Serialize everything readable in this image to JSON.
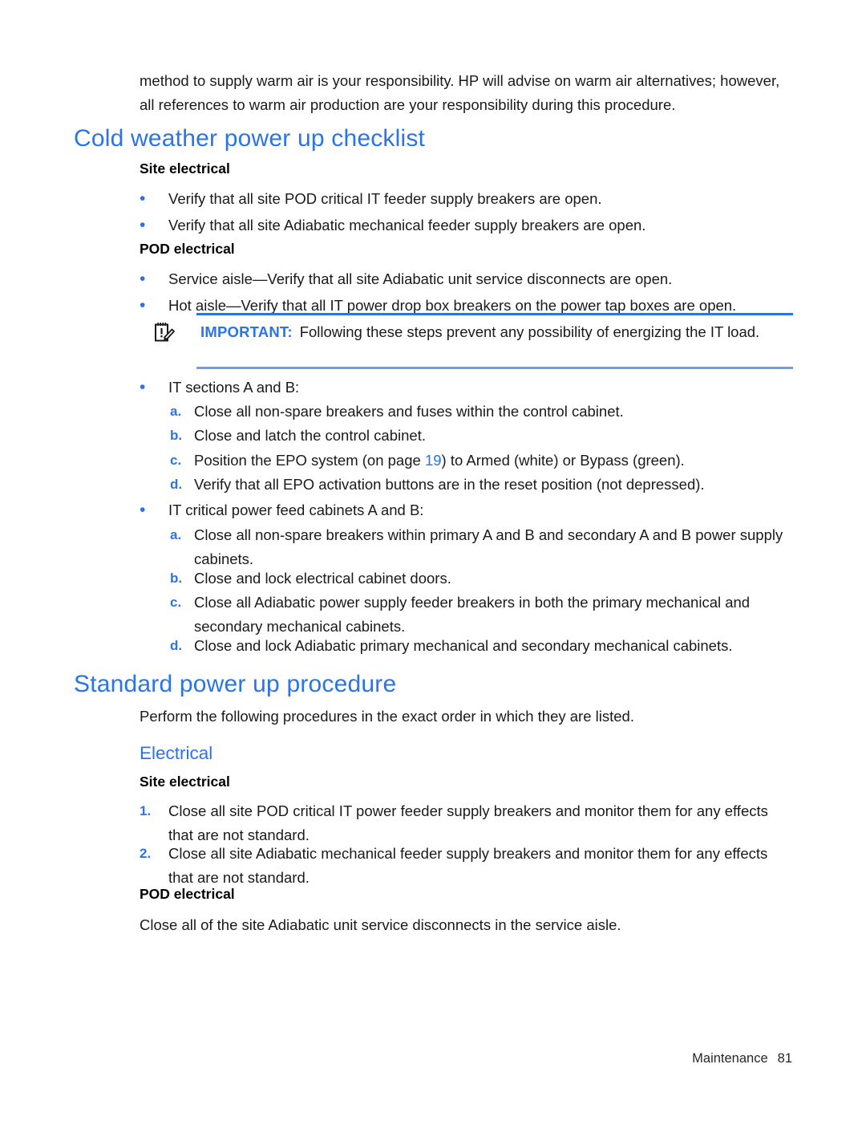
{
  "document": {
    "intro_paragraph": "method to supply warm air is your responsibility. HP will advise on warm air alternatives; however, all references to warm air production are your responsibility during this procedure.",
    "accent_color": "#2a74e8",
    "rule_color_top": "#2a74e8",
    "rule_color_bottom": "#6f9eea"
  },
  "section_cold": {
    "heading": "Cold weather power up checklist",
    "site_electrical_heading": "Site electrical",
    "site_electrical_bullets": [
      "Verify that all site POD critical IT feeder supply breakers are open.",
      "Verify that all site Adiabatic mechanical feeder supply breakers are open."
    ],
    "pod_electrical_heading": "POD electrical",
    "pod_electrical_bullets": [
      "Service aisle—Verify that all site Adiabatic unit service disconnects are open.",
      "Hot aisle—Verify that all IT power drop box breakers on the power tap boxes are open."
    ],
    "important_note": {
      "icon": "note-pencil-icon",
      "label": "IMPORTANT:",
      "text": "Following these steps prevent any possibility of energizing the IT load."
    },
    "group_it_sections": {
      "bullet": "IT sections A and B:",
      "steps": [
        {
          "marker": "a.",
          "text_before_link": "Close all non-spare breakers and fuses within the control cabinet.",
          "link": "",
          "text_after_link": ""
        },
        {
          "marker": "b.",
          "text_before_link": "Close and latch the control cabinet.",
          "link": "",
          "text_after_link": ""
        },
        {
          "marker": "c.",
          "text_before_link": "Position the EPO system (on page ",
          "link": "19",
          "text_after_link": ") to Armed (white) or Bypass (green)."
        },
        {
          "marker": "d.",
          "text_before_link": "Verify that all EPO activation buttons are in the reset position (not depressed).",
          "link": "",
          "text_after_link": ""
        }
      ]
    },
    "group_it_critical": {
      "bullet": "IT critical power feed cabinets A and B:",
      "steps": [
        {
          "marker": "a.",
          "text_before_link": "Close all non-spare breakers within primary A and B and secondary A and B power supply cabinets.",
          "link": "",
          "text_after_link": ""
        },
        {
          "marker": "b.",
          "text_before_link": "Close and lock electrical cabinet doors.",
          "link": "",
          "text_after_link": ""
        },
        {
          "marker": "c.",
          "text_before_link": "Close all Adiabatic power supply feeder breakers in both the primary mechanical and secondary mechanical cabinets.",
          "link": "",
          "text_after_link": ""
        },
        {
          "marker": "d.",
          "text_before_link": "Close and lock Adiabatic primary mechanical and secondary mechanical cabinets.",
          "link": "",
          "text_after_link": ""
        }
      ]
    }
  },
  "section_standard": {
    "heading": "Standard power up procedure",
    "intro": "Perform the following procedures in the exact order in which they are listed.",
    "subheading": "Electrical",
    "site_electrical_heading": "Site electrical",
    "numbered_steps": [
      {
        "marker": "1.",
        "text": "Close all site POD critical IT power feeder supply breakers and monitor them for any effects that are not standard."
      },
      {
        "marker": "2.",
        "text": "Close all site Adiabatic mechanical feeder supply breakers and monitor them for any effects that are not standard."
      }
    ],
    "pod_electrical_heading": "POD electrical",
    "pod_electrical_paragraph": "Close all of the site Adiabatic unit service disconnects in the service aisle."
  },
  "footer": {
    "chapter": "Maintenance",
    "page_number": "81"
  }
}
